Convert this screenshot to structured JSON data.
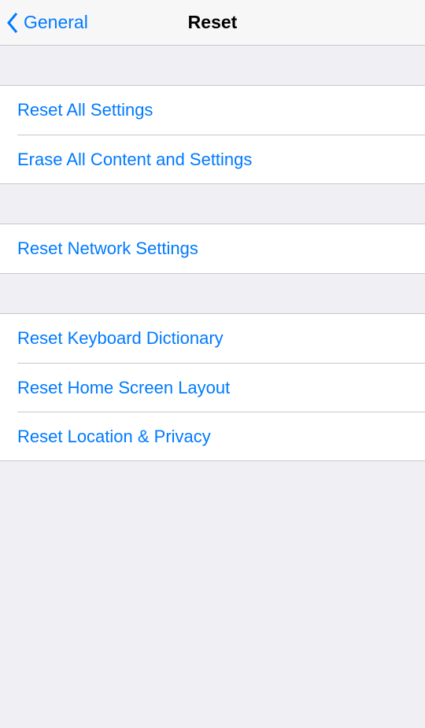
{
  "nav": {
    "back_label": "General",
    "title": "Reset"
  },
  "group1": {
    "items": [
      {
        "label": "Reset All Settings"
      },
      {
        "label": "Erase All Content and Settings"
      }
    ]
  },
  "group2": {
    "items": [
      {
        "label": "Reset Network Settings"
      }
    ]
  },
  "group3": {
    "items": [
      {
        "label": "Reset Keyboard Dictionary"
      },
      {
        "label": "Reset Home Screen Layout"
      },
      {
        "label": "Reset Location & Privacy"
      }
    ]
  }
}
